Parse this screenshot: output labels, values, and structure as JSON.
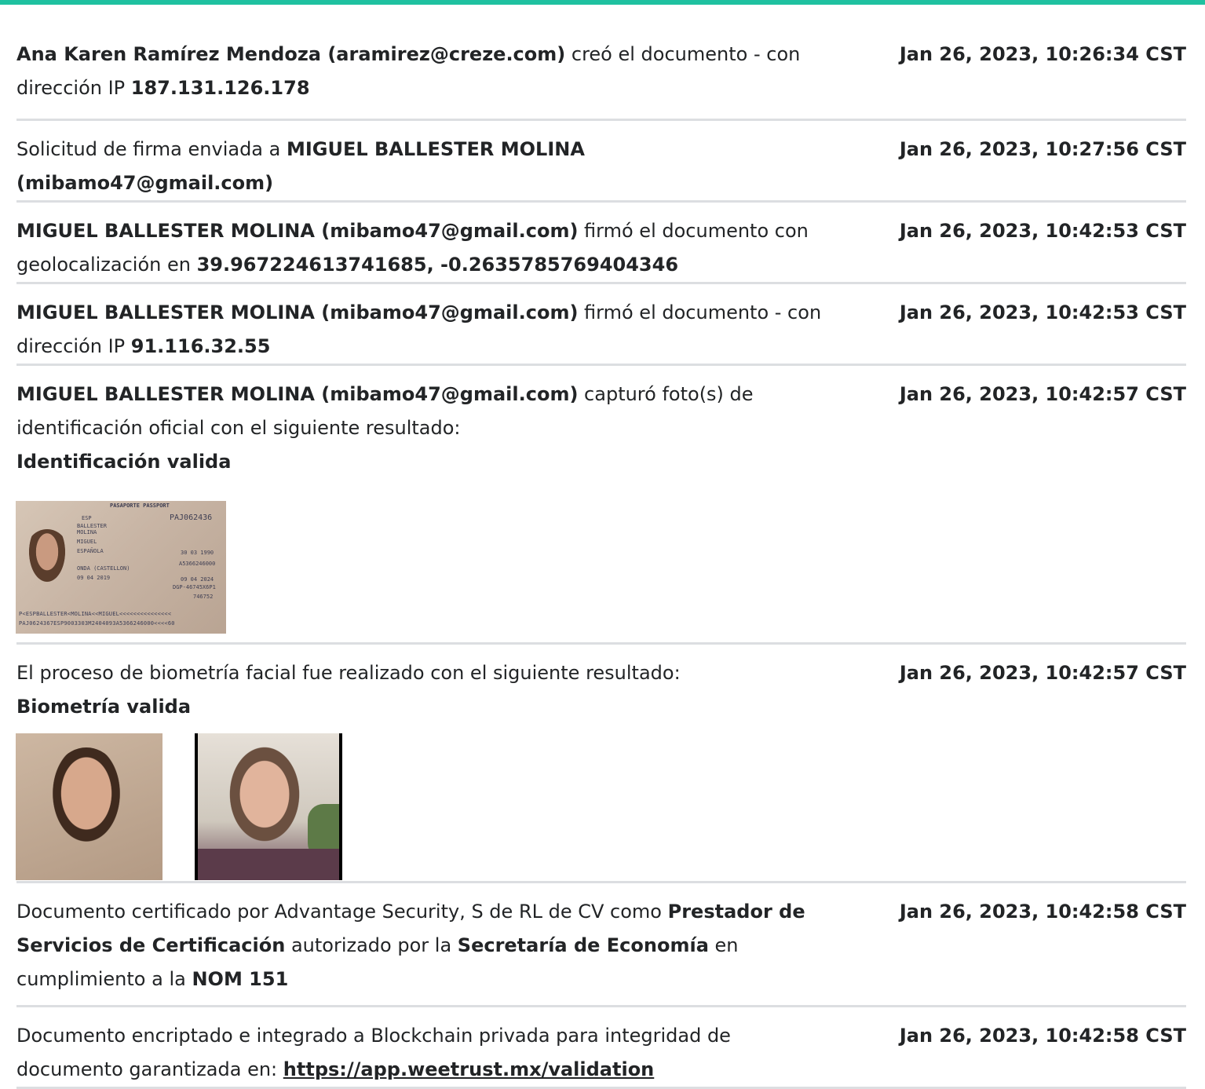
{
  "colors": {
    "accent": "#1fc1a0",
    "divider": "#dcdee1",
    "text": "#222426"
  },
  "events": [
    {
      "parts": [
        {
          "text": "Ana Karen Ramírez Mendoza (aramirez@creze.com)",
          "bold": true
        },
        {
          "text": " creó el documento - con dirección IP "
        },
        {
          "text": "187.131.126.178",
          "bold": true
        }
      ],
      "timestamp": "Jan 26, 2023, 10:26:34 CST"
    },
    {
      "parts": [
        {
          "text": "Solicitud de firma enviada a "
        },
        {
          "text": "MIGUEL BALLESTER MOLINA (mibamo47@gmail.com)",
          "bold": true
        }
      ],
      "timestamp": "Jan 26, 2023, 10:27:56 CST"
    },
    {
      "parts": [
        {
          "text": "MIGUEL BALLESTER MOLINA (mibamo47@gmail.com)",
          "bold": true
        },
        {
          "text": " firmó el documento con geolocalización en "
        },
        {
          "text": "39.967224613741685, -0.2635785769404346",
          "bold": true
        }
      ],
      "timestamp": "Jan 26, 2023, 10:42:53 CST"
    },
    {
      "parts": [
        {
          "text": "MIGUEL BALLESTER MOLINA (mibamo47@gmail.com)",
          "bold": true
        },
        {
          "text": " firmó el documento - con dirección IP "
        },
        {
          "text": "91.116.32.55",
          "bold": true
        }
      ],
      "timestamp": "Jan 26, 2023, 10:42:53 CST"
    },
    {
      "parts": [
        {
          "text": "MIGUEL BALLESTER MOLINA (mibamo47@gmail.com)",
          "bold": true
        },
        {
          "text": " capturó foto(s) de identificación oficial con el siguiente resultado:"
        },
        {
          "br": true
        },
        {
          "text": "Identificación valida",
          "bold": true
        }
      ],
      "timestamp": "Jan 26, 2023, 10:42:57 CST",
      "images": [
        "passport-photo"
      ]
    },
    {
      "parts": [
        {
          "text": "El proceso de biometría facial fue realizado con el siguiente resultado:"
        },
        {
          "br": true
        },
        {
          "text": "Biometría valida",
          "bold": true
        }
      ],
      "timestamp": "Jan 26, 2023, 10:42:57 CST",
      "images": [
        "id-face-photo",
        "selfie-photo"
      ]
    },
    {
      "parts": [
        {
          "text": "Documento certificado por Advantage Security, S de RL de CV como "
        },
        {
          "text": "Prestador de Servicios de Certificación",
          "bold": true
        },
        {
          "text": " autorizado por la "
        },
        {
          "text": "Secretaría de Economía",
          "bold": true
        },
        {
          "text": " en cumplimiento a la "
        },
        {
          "text": "NOM 151",
          "bold": true
        }
      ],
      "timestamp": "Jan 26, 2023, 10:42:58 CST"
    },
    {
      "parts": [
        {
          "text": "Documento encriptado e integrado a Blockchain privada para integridad de documento garantizada en: "
        },
        {
          "text": "https://app.weetrust.mx/validation",
          "link": true
        }
      ],
      "timestamp": "Jan 26, 2023, 10:42:58 CST"
    }
  ],
  "passport": {
    "header": "PASAPORTE   PASSPORT",
    "number": "PAJ062436",
    "code": "ESP",
    "surname1": "BALLESTER",
    "surname2": "MOLINA",
    "name": "MIGUEL",
    "nationality": "ESPAÑOLA",
    "birth_date": "30 03 1990",
    "id_number": "A5366246000",
    "birthplace": "ONDA (CASTELLON)",
    "issue_date": "09 04 2019",
    "expiry_date": "09 04 2024",
    "authority": "DGP-46745X6P1",
    "office": "746752",
    "mrz1": "P<ESPBALLESTER<MOLINA<<MIGUEL<<<<<<<<<<<<<<<",
    "mrz2": "PAJ0624367ESP9003303M2404093A5366246000<<<<60"
  }
}
